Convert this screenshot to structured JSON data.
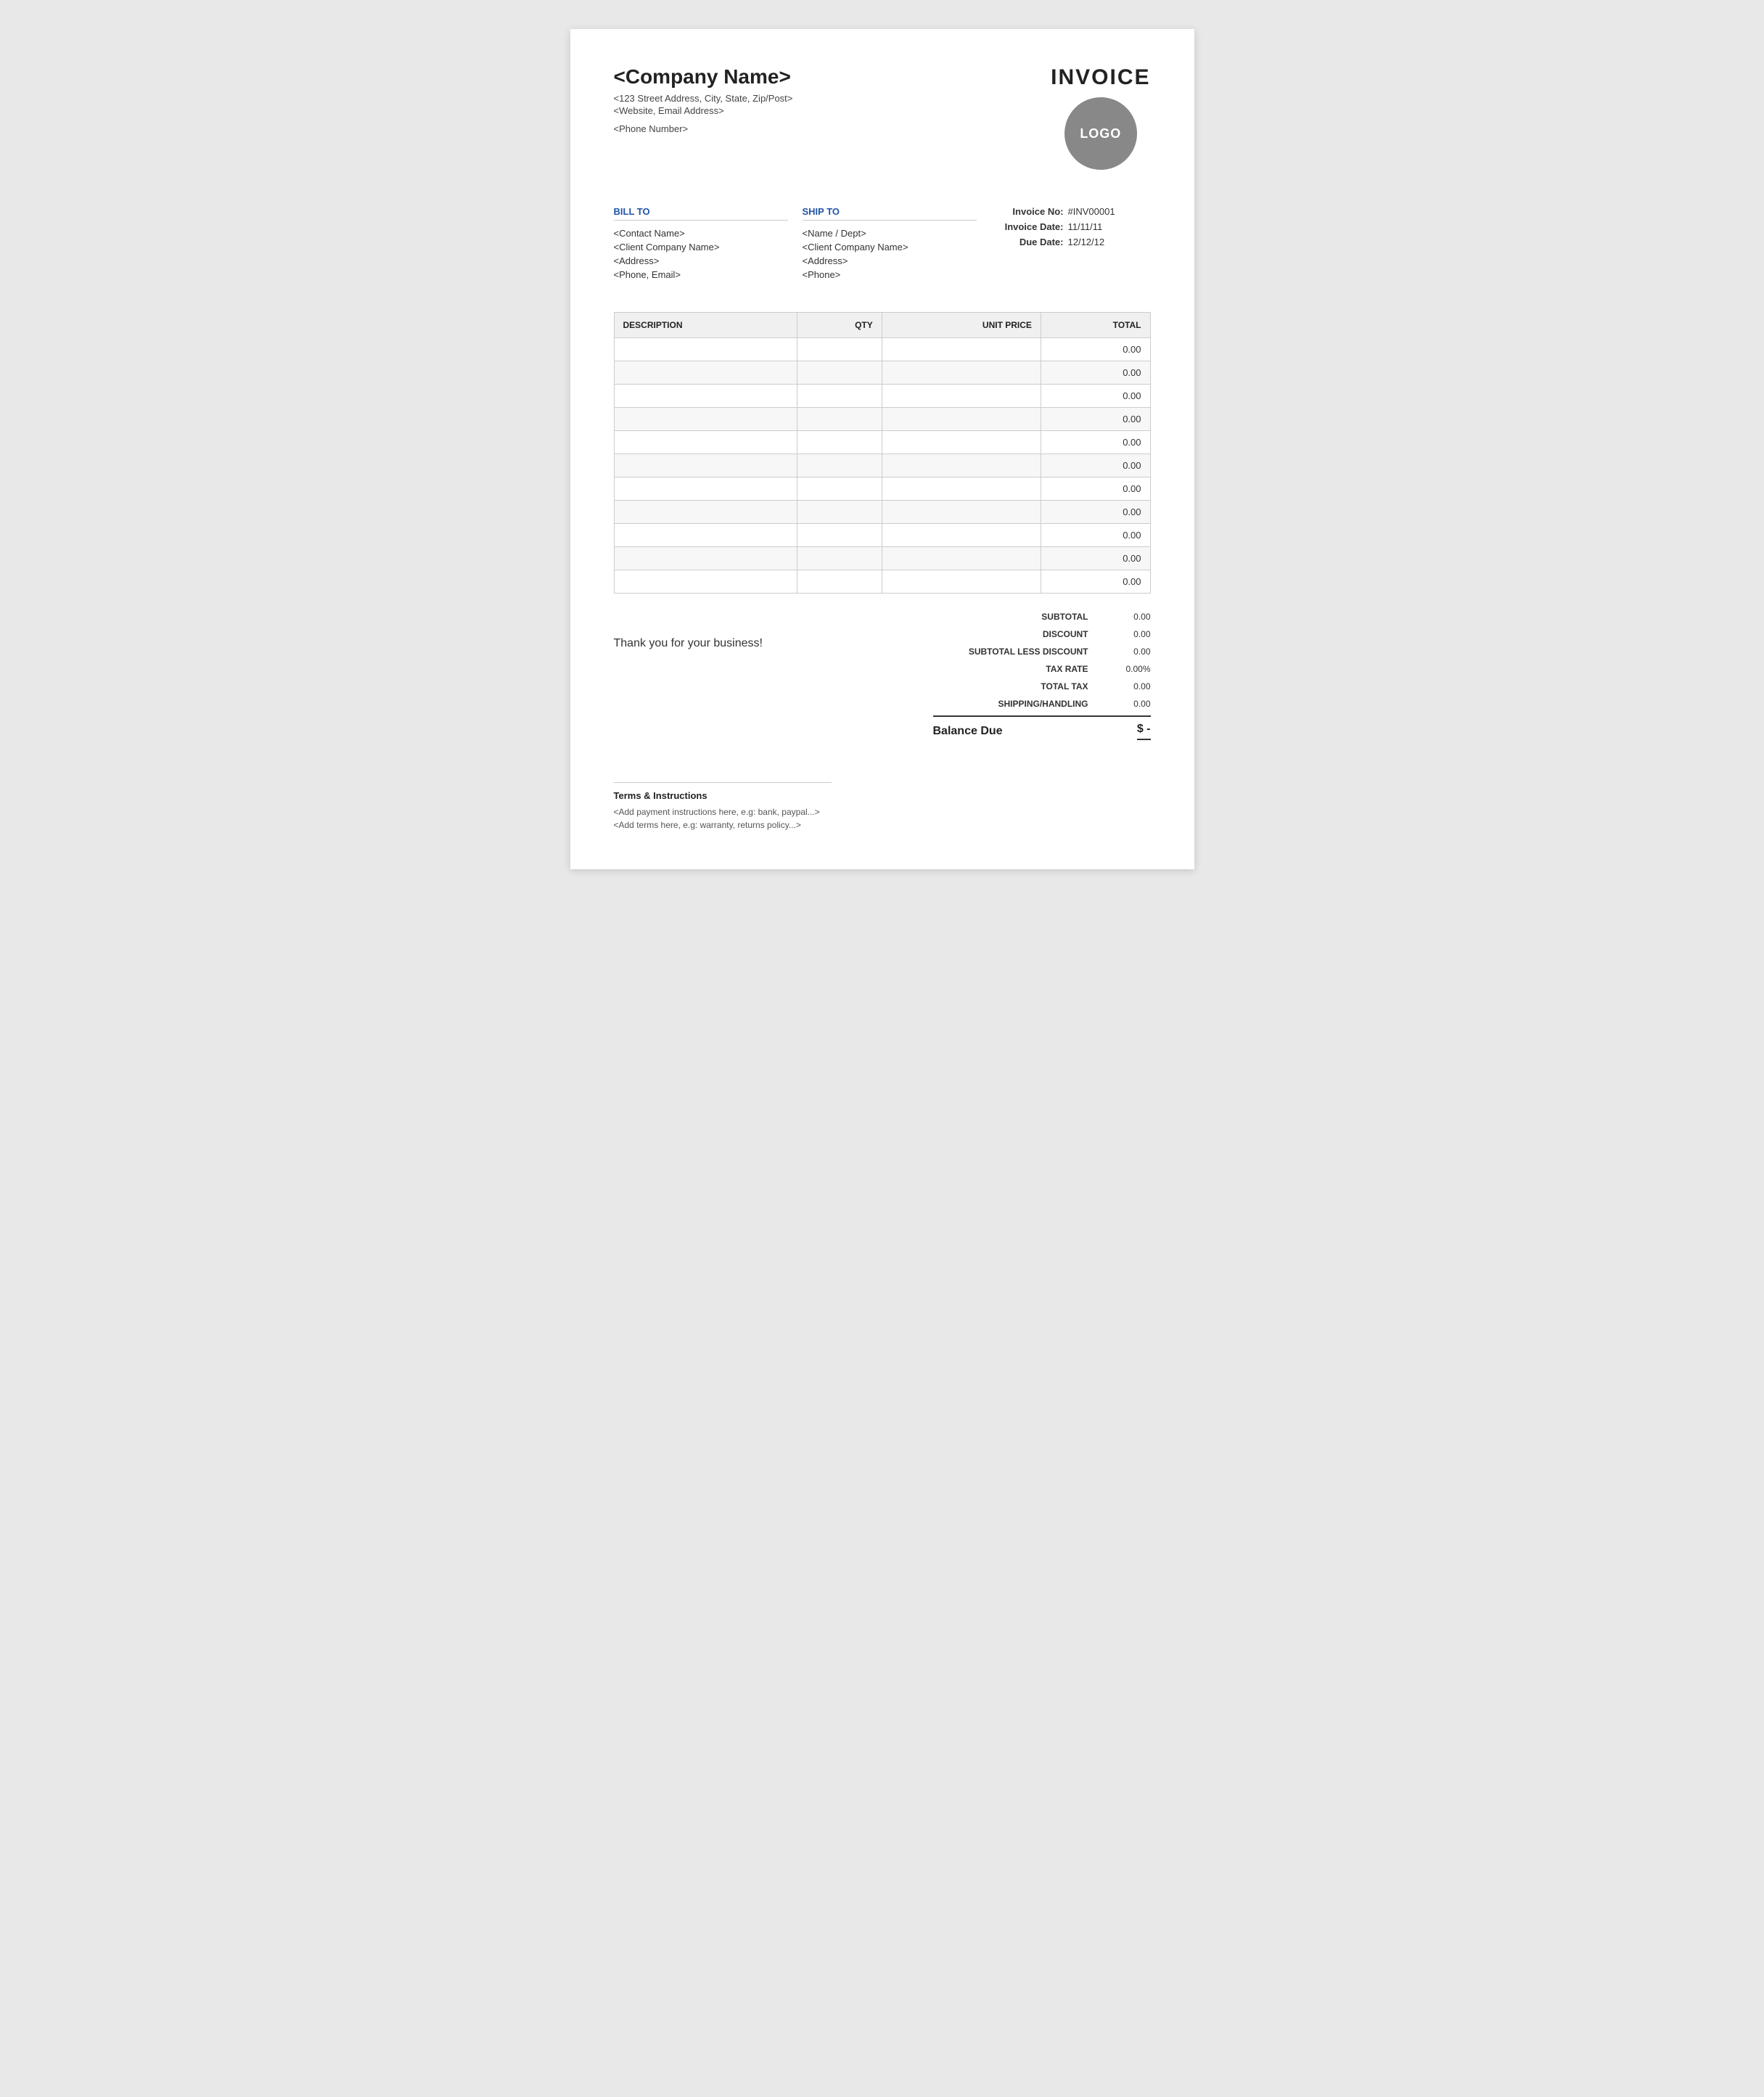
{
  "header": {
    "invoice_title": "INVOICE",
    "company_name": "<Company Name>",
    "company_address": "<123 Street Address, City, State, Zip/Post>",
    "company_website": "<Website, Email Address>",
    "company_phone": "<Phone Number>",
    "logo_label": "LOGO"
  },
  "bill_to": {
    "label": "BILL TO",
    "contact_name": "<Contact Name>",
    "company_name": "<Client Company Name>",
    "address": "<Address>",
    "phone_email": "<Phone, Email>"
  },
  "ship_to": {
    "label": "SHIP TO",
    "name_dept": "<Name / Dept>",
    "company_name": "<Client Company Name>",
    "address": "<Address>",
    "phone": "<Phone>"
  },
  "invoice_meta": {
    "invoice_no_label": "Invoice No:",
    "invoice_no_value": "#INV00001",
    "invoice_date_label": "Invoice Date:",
    "invoice_date_value": "11/11/11",
    "due_date_label": "Due Date:",
    "due_date_value": "12/12/12"
  },
  "table": {
    "headers": {
      "description": "DESCRIPTION",
      "qty": "QTY",
      "unit_price": "UNIT PRICE",
      "total": "TOTAL"
    },
    "rows": [
      {
        "description": "",
        "qty": "",
        "unit_price": "",
        "total": "0.00"
      },
      {
        "description": "",
        "qty": "",
        "unit_price": "",
        "total": "0.00"
      },
      {
        "description": "",
        "qty": "",
        "unit_price": "",
        "total": "0.00"
      },
      {
        "description": "",
        "qty": "",
        "unit_price": "",
        "total": "0.00"
      },
      {
        "description": "",
        "qty": "",
        "unit_price": "",
        "total": "0.00"
      },
      {
        "description": "",
        "qty": "",
        "unit_price": "",
        "total": "0.00"
      },
      {
        "description": "",
        "qty": "",
        "unit_price": "",
        "total": "0.00"
      },
      {
        "description": "",
        "qty": "",
        "unit_price": "",
        "total": "0.00"
      },
      {
        "description": "",
        "qty": "",
        "unit_price": "",
        "total": "0.00"
      },
      {
        "description": "",
        "qty": "",
        "unit_price": "",
        "total": "0.00"
      },
      {
        "description": "",
        "qty": "",
        "unit_price": "",
        "total": "0.00"
      }
    ]
  },
  "totals": {
    "subtotal_label": "SUBTOTAL",
    "subtotal_value": "0.00",
    "discount_label": "DISCOUNT",
    "discount_value": "0.00",
    "subtotal_less_discount_label": "SUBTOTAL LESS DISCOUNT",
    "subtotal_less_discount_value": "0.00",
    "tax_rate_label": "TAX RATE",
    "tax_rate_value": "0.00%",
    "total_tax_label": "TOTAL TAX",
    "total_tax_value": "0.00",
    "shipping_handling_label": "SHIPPING/HANDLING",
    "shipping_handling_value": "0.00",
    "balance_due_label": "Balance Due",
    "balance_due_currency": "$",
    "balance_due_value": "-"
  },
  "thank_you": "Thank you for your business!",
  "terms": {
    "title": "Terms & Instructions",
    "payment_instructions": "<Add payment instructions here, e.g: bank, paypal...>",
    "policy": "<Add terms here, e.g: warranty, returns policy...>"
  }
}
